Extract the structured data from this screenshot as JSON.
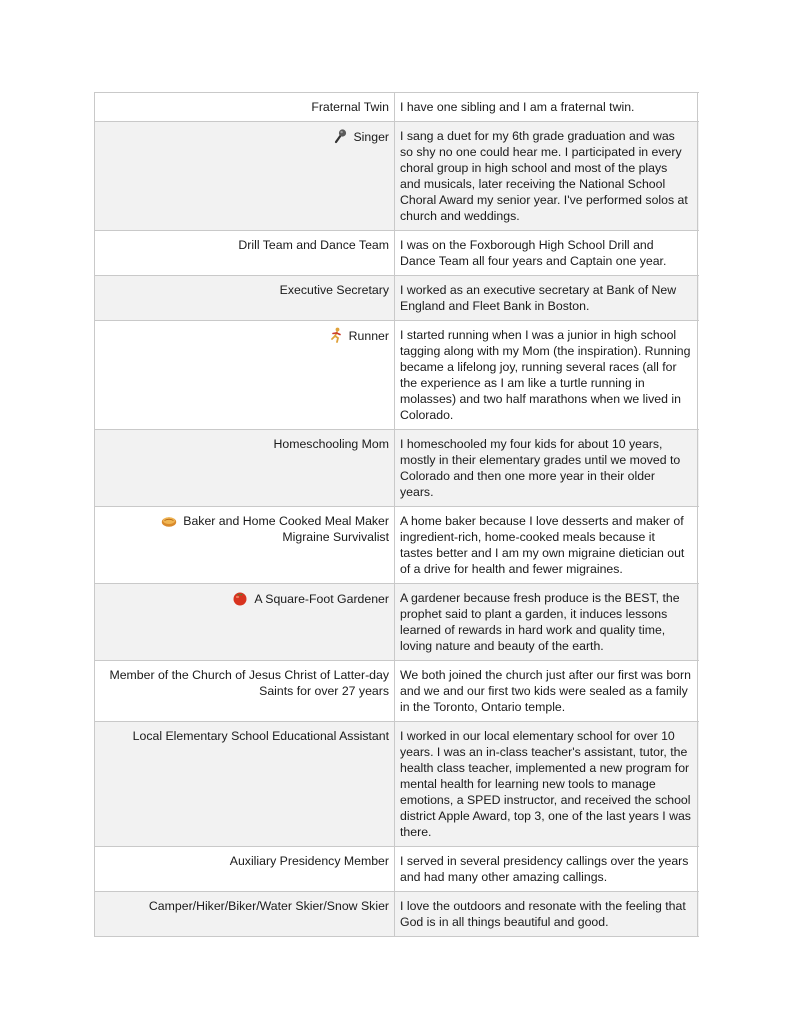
{
  "rows": [
    {
      "label": "Fraternal Twin",
      "icon": null,
      "shaded": false,
      "description": "I have one sibling and I am a fraternal twin."
    },
    {
      "label": "Singer",
      "icon": "microphone-icon",
      "shaded": true,
      "description": "I sang a duet for my 6th grade graduation and was so shy no one could hear me. I participated in every choral group in high school and most of the plays and musicals, later receiving the National School Choral Award my senior year. I've performed solos at church and weddings."
    },
    {
      "label": "Drill Team and Dance Team",
      "icon": null,
      "shaded": false,
      "description": "I was on the Foxborough High School Drill and Dance Team all four years and Captain one year."
    },
    {
      "label": "Executive Secretary",
      "icon": null,
      "shaded": true,
      "description": "I worked as an executive secretary at Bank of New England and Fleet Bank in Boston."
    },
    {
      "label": "Runner",
      "icon": "runner-icon",
      "shaded": false,
      "description": "I started running when I was a junior in high school tagging along with my Mom (the inspiration). Running became a lifelong joy, running several races (all for the experience as I am like a turtle running in molasses) and two half marathons when we lived in Colorado."
    },
    {
      "label": "Homeschooling Mom",
      "icon": null,
      "shaded": true,
      "description": "I homeschooled my four kids for about 10 years, mostly in their elementary grades until we moved to Colorado and then one more year in their older years."
    },
    {
      "label": "Baker and Home Cooked Meal Maker",
      "label2": "Migraine Survivalist",
      "icon": "pie-icon",
      "shaded": false,
      "description": "A home baker because I love desserts and maker of ingredient-rich, home-cooked meals because it tastes better and I am my own migraine dietician out of a drive for health and fewer migraines."
    },
    {
      "label": "A Square-Foot Gardener",
      "icon": "tomato-icon",
      "shaded": true,
      "description": "A gardener because fresh produce is the BEST, the prophet said to plant a garden, it induces lessons learned of rewards in hard work and quality time, loving nature and beauty of the earth."
    },
    {
      "label": "Member of the Church of Jesus Christ of Latter-day Saints for over 27 years",
      "icon": null,
      "shaded": false,
      "description": "We both joined the church just after our first was born and we and our first two kids were sealed as a family in the Toronto, Ontario temple."
    },
    {
      "label": "Local Elementary School Educational Assistant",
      "icon": null,
      "shaded": true,
      "description": "I worked in our local elementary school for over 10 years. I was an in-class teacher's assistant, tutor, the health class teacher, implemented a new program for mental health for learning new tools to manage emotions, a SPED instructor, and received the school district Apple Award, top 3, one of the last years I was there."
    },
    {
      "label": "Auxiliary Presidency Member",
      "icon": null,
      "shaded": false,
      "description": "I served in several presidency callings over the years and had many other amazing callings."
    },
    {
      "label": "Camper/Hiker/Biker/Water Skier/Snow Skier",
      "icon": null,
      "shaded": true,
      "description": "I love the outdoors and resonate with the feeling that God is in all things beautiful and good."
    }
  ]
}
